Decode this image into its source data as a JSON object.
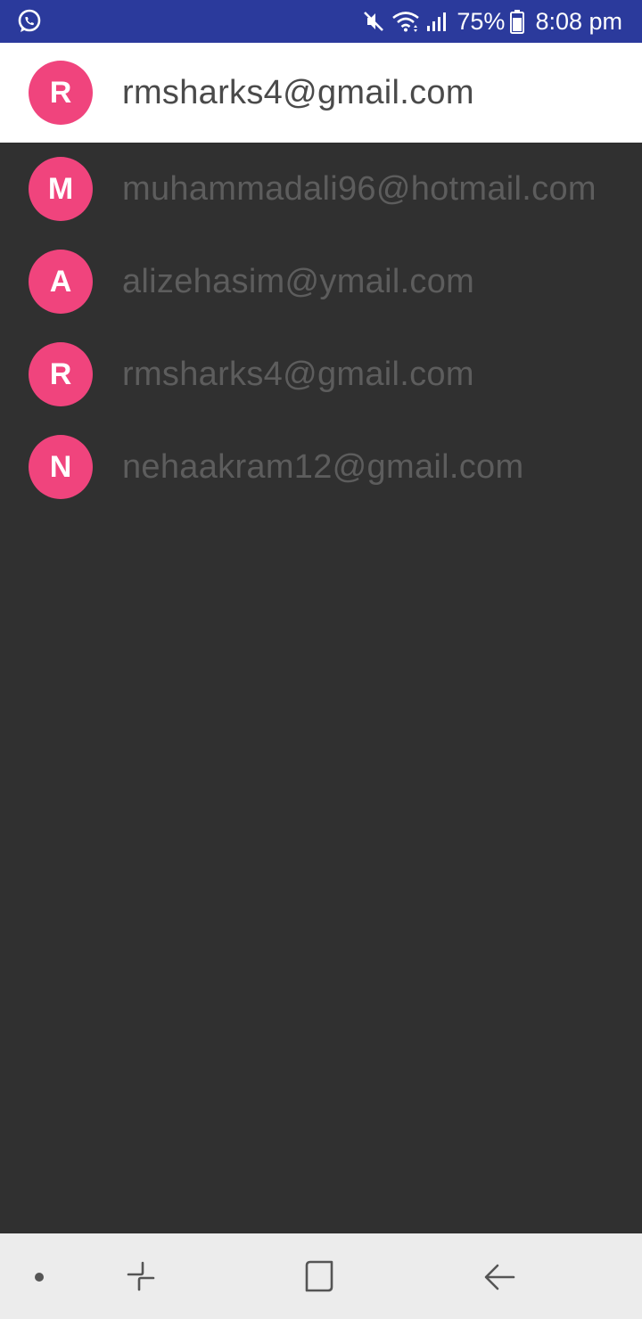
{
  "status_bar": {
    "left_icon": "whatsapp-icon",
    "icons": [
      "mute-icon",
      "wifi-icon",
      "signal-icon",
      "battery-icon"
    ],
    "battery_percent": "75%",
    "time": "8:08 pm"
  },
  "accounts": [
    {
      "initial": "R",
      "email": "rmsharks4@gmail.com",
      "selected": true
    },
    {
      "initial": "M",
      "email": "muhammadali96@hotmail.com",
      "selected": false
    },
    {
      "initial": "A",
      "email": "alizehasim@ymail.com",
      "selected": false
    },
    {
      "initial": "R",
      "email": "rmsharks4@gmail.com",
      "selected": false
    },
    {
      "initial": "N",
      "email": "nehaakram12@gmail.com",
      "selected": false
    }
  ],
  "nav_bar": {
    "buttons": [
      "dot-icon",
      "recents-icon",
      "home-icon",
      "back-icon"
    ]
  },
  "colors": {
    "status_bar": "#2b3a9c",
    "avatar": "#f0447d",
    "background": "#303030",
    "selected_row": "#ffffff",
    "nav_bar": "#ececec"
  }
}
